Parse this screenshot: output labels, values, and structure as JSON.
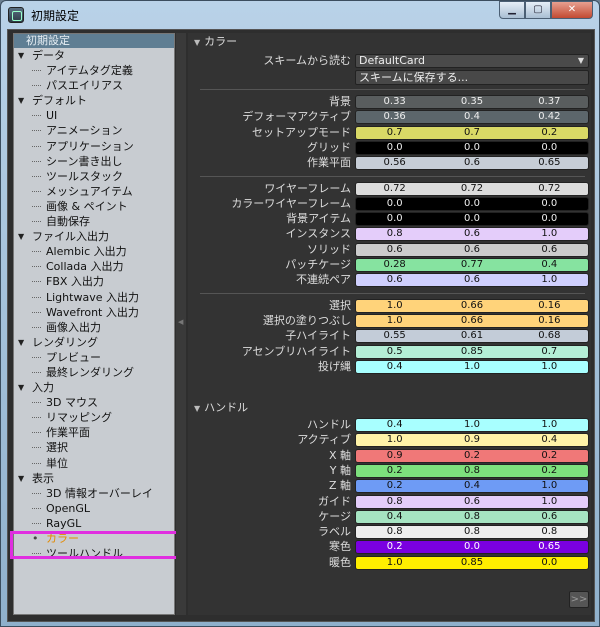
{
  "window": {
    "title": "初期設定"
  },
  "tree": {
    "header": "初期設定",
    "items": [
      {
        "label": "データ",
        "type": "cat"
      },
      {
        "label": "アイテムタグ定義",
        "type": "leaf"
      },
      {
        "label": "パスエイリアス",
        "type": "leaf"
      },
      {
        "label": "デフォルト",
        "type": "cat"
      },
      {
        "label": "UI",
        "type": "leaf"
      },
      {
        "label": "アニメーション",
        "type": "leaf"
      },
      {
        "label": "アプリケーション",
        "type": "leaf"
      },
      {
        "label": "シーン書き出し",
        "type": "leaf"
      },
      {
        "label": "ツールスタック",
        "type": "leaf"
      },
      {
        "label": "メッシュアイテム",
        "type": "leaf"
      },
      {
        "label": "画像 & ペイント",
        "type": "leaf"
      },
      {
        "label": "自動保存",
        "type": "leaf"
      },
      {
        "label": "ファイル入出力",
        "type": "cat"
      },
      {
        "label": "Alembic 入出力",
        "type": "leaf"
      },
      {
        "label": "Collada 入出力",
        "type": "leaf"
      },
      {
        "label": "FBX 入出力",
        "type": "leaf"
      },
      {
        "label": "Lightwave 入出力",
        "type": "leaf"
      },
      {
        "label": "Wavefront 入出力",
        "type": "leaf"
      },
      {
        "label": "画像入出力",
        "type": "leaf"
      },
      {
        "label": "レンダリング",
        "type": "cat"
      },
      {
        "label": "プレビュー",
        "type": "leaf"
      },
      {
        "label": "最終レンダリング",
        "type": "leaf"
      },
      {
        "label": "入力",
        "type": "cat"
      },
      {
        "label": "3D マウス",
        "type": "leaf"
      },
      {
        "label": "リマッピング",
        "type": "leaf"
      },
      {
        "label": "作業平面",
        "type": "leaf"
      },
      {
        "label": "選択",
        "type": "leaf"
      },
      {
        "label": "単位",
        "type": "leaf"
      },
      {
        "label": "表示",
        "type": "cat"
      },
      {
        "label": "3D 情報オーバーレイ",
        "type": "leaf"
      },
      {
        "label": "OpenGL",
        "type": "leaf"
      },
      {
        "label": "RayGL",
        "type": "leaf"
      },
      {
        "label": "カラー",
        "type": "leaf",
        "selected": true
      },
      {
        "label": "ツールハンドル",
        "type": "leaf"
      }
    ]
  },
  "colors_section": {
    "title": "カラー",
    "scheme_label": "スキームから読む",
    "scheme_value": "DefaultCard",
    "save_label": "スキームに保存する...",
    "rows": [
      {
        "label": "背景",
        "values": [
          "0.33",
          "0.35",
          "0.37"
        ],
        "swatch": "#595d5e",
        "text": "#eeeeee",
        "group": 1
      },
      {
        "label": "デフォーマアクティブ",
        "values": [
          "0.36",
          "0.4",
          "0.42"
        ],
        "swatch": "#5c666b",
        "text": "#eeeeee",
        "group": 1
      },
      {
        "label": "セットアップモード",
        "values": [
          "0.7",
          "0.7",
          "0.2"
        ],
        "swatch": "#d9d966",
        "text": "#111111",
        "group": 1
      },
      {
        "label": "グリッド",
        "values": [
          "0.0",
          "0.0",
          "0.0"
        ],
        "swatch": "#000000",
        "text": "#eeeeee",
        "group": 1
      },
      {
        "label": "作業平面",
        "values": [
          "0.56",
          "0.6",
          "0.65"
        ],
        "swatch": "#c6cdd6",
        "text": "#111111",
        "group": 1
      },
      {
        "label": "ワイヤーフレーム",
        "values": [
          "0.72",
          "0.72",
          "0.72"
        ],
        "swatch": "#dcdcdc",
        "text": "#111111",
        "group": 2
      },
      {
        "label": "カラーワイヤーフレーム",
        "values": [
          "0.0",
          "0.0",
          "0.0"
        ],
        "swatch": "#000000",
        "text": "#eeeeee",
        "group": 2
      },
      {
        "label": "背景アイテム",
        "values": [
          "0.0",
          "0.0",
          "0.0"
        ],
        "swatch": "#000000",
        "text": "#eeeeee",
        "group": 2
      },
      {
        "label": "インスタンス",
        "values": [
          "0.8",
          "0.6",
          "1.0"
        ],
        "swatch": "#e4cdfa",
        "text": "#111111",
        "group": 2
      },
      {
        "label": "ソリッド",
        "values": [
          "0.6",
          "0.6",
          "0.6"
        ],
        "swatch": "#cccccc",
        "text": "#111111",
        "group": 2
      },
      {
        "label": "パッチケージ",
        "values": [
          "0.28",
          "0.77",
          "0.4"
        ],
        "swatch": "#86e3a0",
        "text": "#111111",
        "group": 2
      },
      {
        "label": "不連続ペア",
        "values": [
          "0.6",
          "0.6",
          "1.0"
        ],
        "swatch": "#cfcffd",
        "text": "#111111",
        "group": 2
      },
      {
        "label": "選択",
        "values": [
          "1.0",
          "0.66",
          "0.16"
        ],
        "swatch": "#ffd37a",
        "text": "#111111",
        "group": 3
      },
      {
        "label": "選択の塗りつぶし",
        "values": [
          "1.0",
          "0.66",
          "0.16"
        ],
        "swatch": "#ffd37a",
        "text": "#111111",
        "group": 3
      },
      {
        "label": "子ハイライト",
        "values": [
          "0.55",
          "0.61",
          "0.68"
        ],
        "swatch": "#c3ccd8",
        "text": "#111111",
        "group": 3
      },
      {
        "label": "アセンブリハイライト",
        "values": [
          "0.5",
          "0.85",
          "0.7"
        ],
        "swatch": "#b4eed6",
        "text": "#111111",
        "group": 3
      },
      {
        "label": "投げ縄",
        "values": [
          "0.4",
          "1.0",
          "1.0"
        ],
        "swatch": "#a8ffff",
        "text": "#111111",
        "group": 3
      }
    ]
  },
  "handles_section": {
    "title": "ハンドル",
    "rows": [
      {
        "label": "ハンドル",
        "values": [
          "0.4",
          "1.0",
          "1.0"
        ],
        "swatch": "#a8ffff",
        "text": "#111111"
      },
      {
        "label": "アクティブ",
        "values": [
          "1.0",
          "0.9",
          "0.4"
        ],
        "swatch": "#fff3a8",
        "text": "#111111"
      },
      {
        "label": "X 軸",
        "values": [
          "0.9",
          "0.2",
          "0.2"
        ],
        "swatch": "#f07878",
        "text": "#111111"
      },
      {
        "label": "Y 軸",
        "values": [
          "0.2",
          "0.8",
          "0.2"
        ],
        "swatch": "#7de07d",
        "text": "#111111"
      },
      {
        "label": "Z 軸",
        "values": [
          "0.2",
          "0.4",
          "1.0"
        ],
        "swatch": "#6e9bf5",
        "text": "#111111"
      },
      {
        "label": "ガイド",
        "values": [
          "0.8",
          "0.6",
          "1.0"
        ],
        "swatch": "#e4cdfa",
        "text": "#111111"
      },
      {
        "label": "ケージ",
        "values": [
          "0.4",
          "0.8",
          "0.6"
        ],
        "swatch": "#a6e4c2",
        "text": "#111111"
      },
      {
        "label": "ラベル",
        "values": [
          "0.8",
          "0.8",
          "0.8"
        ],
        "swatch": "#eeeeee",
        "text": "#111111"
      },
      {
        "label": "寒色",
        "values": [
          "0.2",
          "0.0",
          "0.65"
        ],
        "swatch": "#7a00e0",
        "text": "#ffffff"
      },
      {
        "label": "暖色",
        "values": [
          "1.0",
          "0.85",
          "0.0"
        ],
        "swatch": "#ffee00",
        "text": "#111111"
      }
    ]
  },
  "more_button": ">>"
}
